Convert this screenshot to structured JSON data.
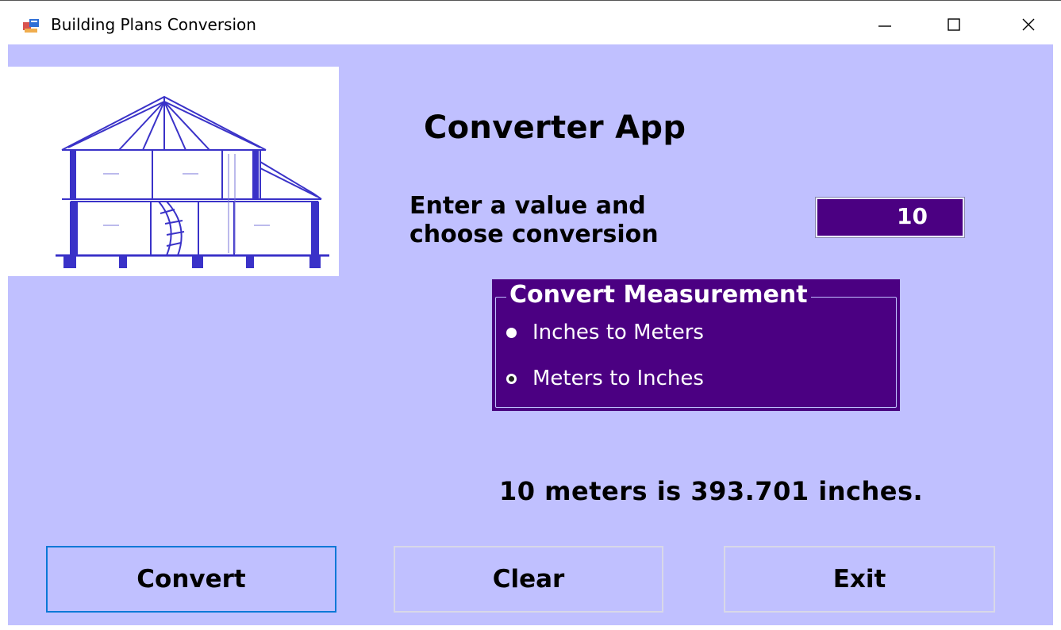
{
  "window": {
    "title": "Building Plans Conversion",
    "minimize_glyph": "—",
    "maximize_glyph": "☐",
    "close_glyph": "✕"
  },
  "main": {
    "app_title": "Converter App",
    "prompt_line1": "Enter a value and",
    "prompt_line2": "choose conversion",
    "input_value": "10",
    "group": {
      "legend": "Convert Measurement",
      "options": [
        {
          "label": "Inches to Meters",
          "checked": false
        },
        {
          "label": "Meters to Inches",
          "checked": true
        }
      ]
    },
    "result": "10 meters is 393.701 inches."
  },
  "buttons": {
    "convert": "Convert",
    "clear": "Clear",
    "exit": "Exit"
  },
  "colors": {
    "background": "#c0c0ff",
    "accent": "#4b0082",
    "focus_border": "#0a78d7"
  },
  "icons": {
    "app": "app-window-icon",
    "picture": "house-cross-section-drawing"
  }
}
